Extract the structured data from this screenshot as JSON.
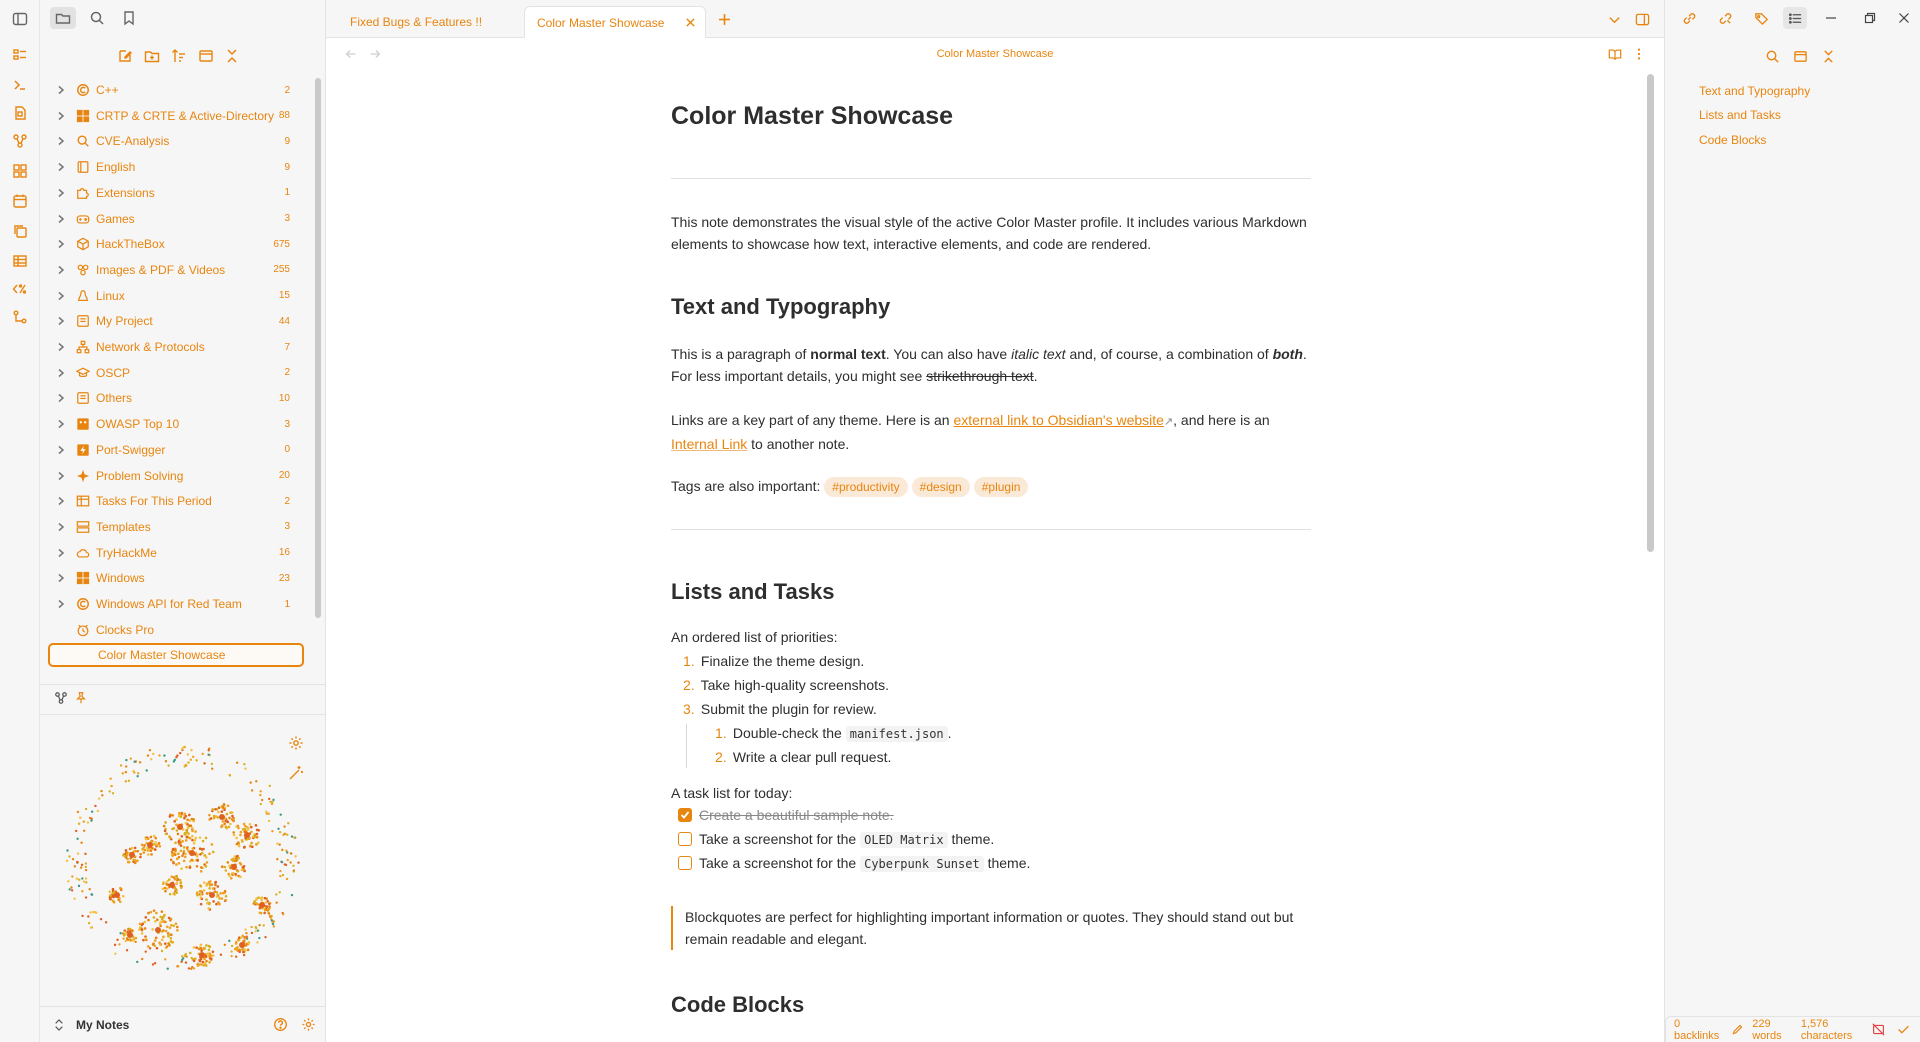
{
  "tabs": [
    {
      "label": "Fixed Bugs & Features !!"
    },
    {
      "label": "Color Master Showcase"
    }
  ],
  "file_tree": [
    {
      "label": "C++",
      "count": "2",
      "icon": "c-logo-icon"
    },
    {
      "label": "CRTP  & CRTE & Active-Directory",
      "count": "88",
      "icon": "windows-icon"
    },
    {
      "label": "CVE-Analysis",
      "count": "9",
      "icon": "magnifier-icon"
    },
    {
      "label": "English",
      "count": "9",
      "icon": "book-icon"
    },
    {
      "label": "Extensions",
      "count": "1",
      "icon": "puzzle-icon"
    },
    {
      "label": "Games",
      "count": "3",
      "icon": "gamepad-icon"
    },
    {
      "label": "HackTheBox",
      "count": "675",
      "icon": "cube-icon"
    },
    {
      "label": "Images & PDF & Videos",
      "count": "255",
      "icon": "media-icon"
    },
    {
      "label": "Linux",
      "count": "15",
      "icon": "linux-icon"
    },
    {
      "label": "My Project",
      "count": "44",
      "icon": "folder-icon"
    },
    {
      "label": "Network & Protocols",
      "count": "7",
      "icon": "network-icon"
    },
    {
      "label": "OSCP",
      "count": "2",
      "icon": "graduation-icon"
    },
    {
      "label": "Others",
      "count": "10",
      "icon": "folder-icon"
    },
    {
      "label": "OWASP Top 10",
      "count": "3",
      "icon": "owasp-icon"
    },
    {
      "label": "Port-Swigger",
      "count": "0",
      "icon": "burp-icon"
    },
    {
      "label": "Problem Solving",
      "count": "20",
      "icon": "sparkle-icon"
    },
    {
      "label": "Tasks For This Period",
      "count": "2",
      "icon": "checklist-icon"
    },
    {
      "label": "Templates",
      "count": "3",
      "icon": "layout-icon"
    },
    {
      "label": "TryHackMe",
      "count": "16",
      "icon": "cloud-icon"
    },
    {
      "label": "Windows",
      "count": "23",
      "icon": "windows-icon"
    },
    {
      "label": "Windows API for Red Team",
      "count": "1",
      "icon": "c-logo-icon"
    }
  ],
  "file_items": [
    {
      "label": "Clocks Pro"
    },
    {
      "label": "Color Master Showcase"
    }
  ],
  "vault": {
    "name": "My Notes"
  },
  "view": {
    "title": "Color Master Showcase"
  },
  "doc": {
    "h1": "Color Master Showcase",
    "intro": "This note demonstrates the visual style of the active Color Master profile. It includes various Markdown elements to showcase how text, interactive elements, and code are rendered.",
    "h2_text": "Text and Typography",
    "p1_a": "This is a paragraph of ",
    "p1_bold": "normal text",
    "p1_b": ". You can also have ",
    "p1_italic": "italic text",
    "p1_c": " and, of course, a combination of ",
    "p1_bolditalic": "both",
    "p1_d": ". For less important details, you might see ",
    "p1_strike": "strikethrough text",
    "p1_e": ".",
    "p2_a": "Links are a key part of any theme. Here is an ",
    "p2_link": "external link to Obsidian's website",
    "p2_b": ", and here is an ",
    "p2_ilink": "Internal Link",
    "p2_c": " to another note.",
    "tags_label": "Tags are also important:",
    "tags": [
      "#productivity",
      "#design",
      "#plugin"
    ],
    "h2_lists": "Lists and Tasks",
    "ordered_label": "An ordered list of priorities:",
    "ordered": [
      "Finalize the theme design.",
      "Take high-quality screenshots.",
      "Submit the plugin for review."
    ],
    "nested_1a": "Double-check the ",
    "nested_1code": "manifest.json",
    "nested_1b": ".",
    "nested_2": "Write a clear pull request.",
    "task_label": "A task list for today:",
    "task1": "Create a beautiful sample note.",
    "task2a": "Take a screenshot for the ",
    "task2code": "OLED Matrix",
    "task2b": " theme.",
    "task3a": "Take a screenshot for the ",
    "task3code": "Cyberpunk Sunset",
    "task3b": " theme.",
    "quote": "Blockquotes are perfect for highlighting important information or quotes. They should stand out but remain readable and elegant.",
    "h2_code": "Code Blocks"
  },
  "outline": [
    "Text and Typography",
    "Lists and Tasks",
    "Code Blocks"
  ],
  "status": {
    "backlinks": "0 backlinks",
    "words": "229 words",
    "chars": "1,576 characters"
  },
  "colors": {
    "accent": "#e8850f",
    "bg": "#ffffff",
    "sidebar": "#f6f6f6"
  }
}
